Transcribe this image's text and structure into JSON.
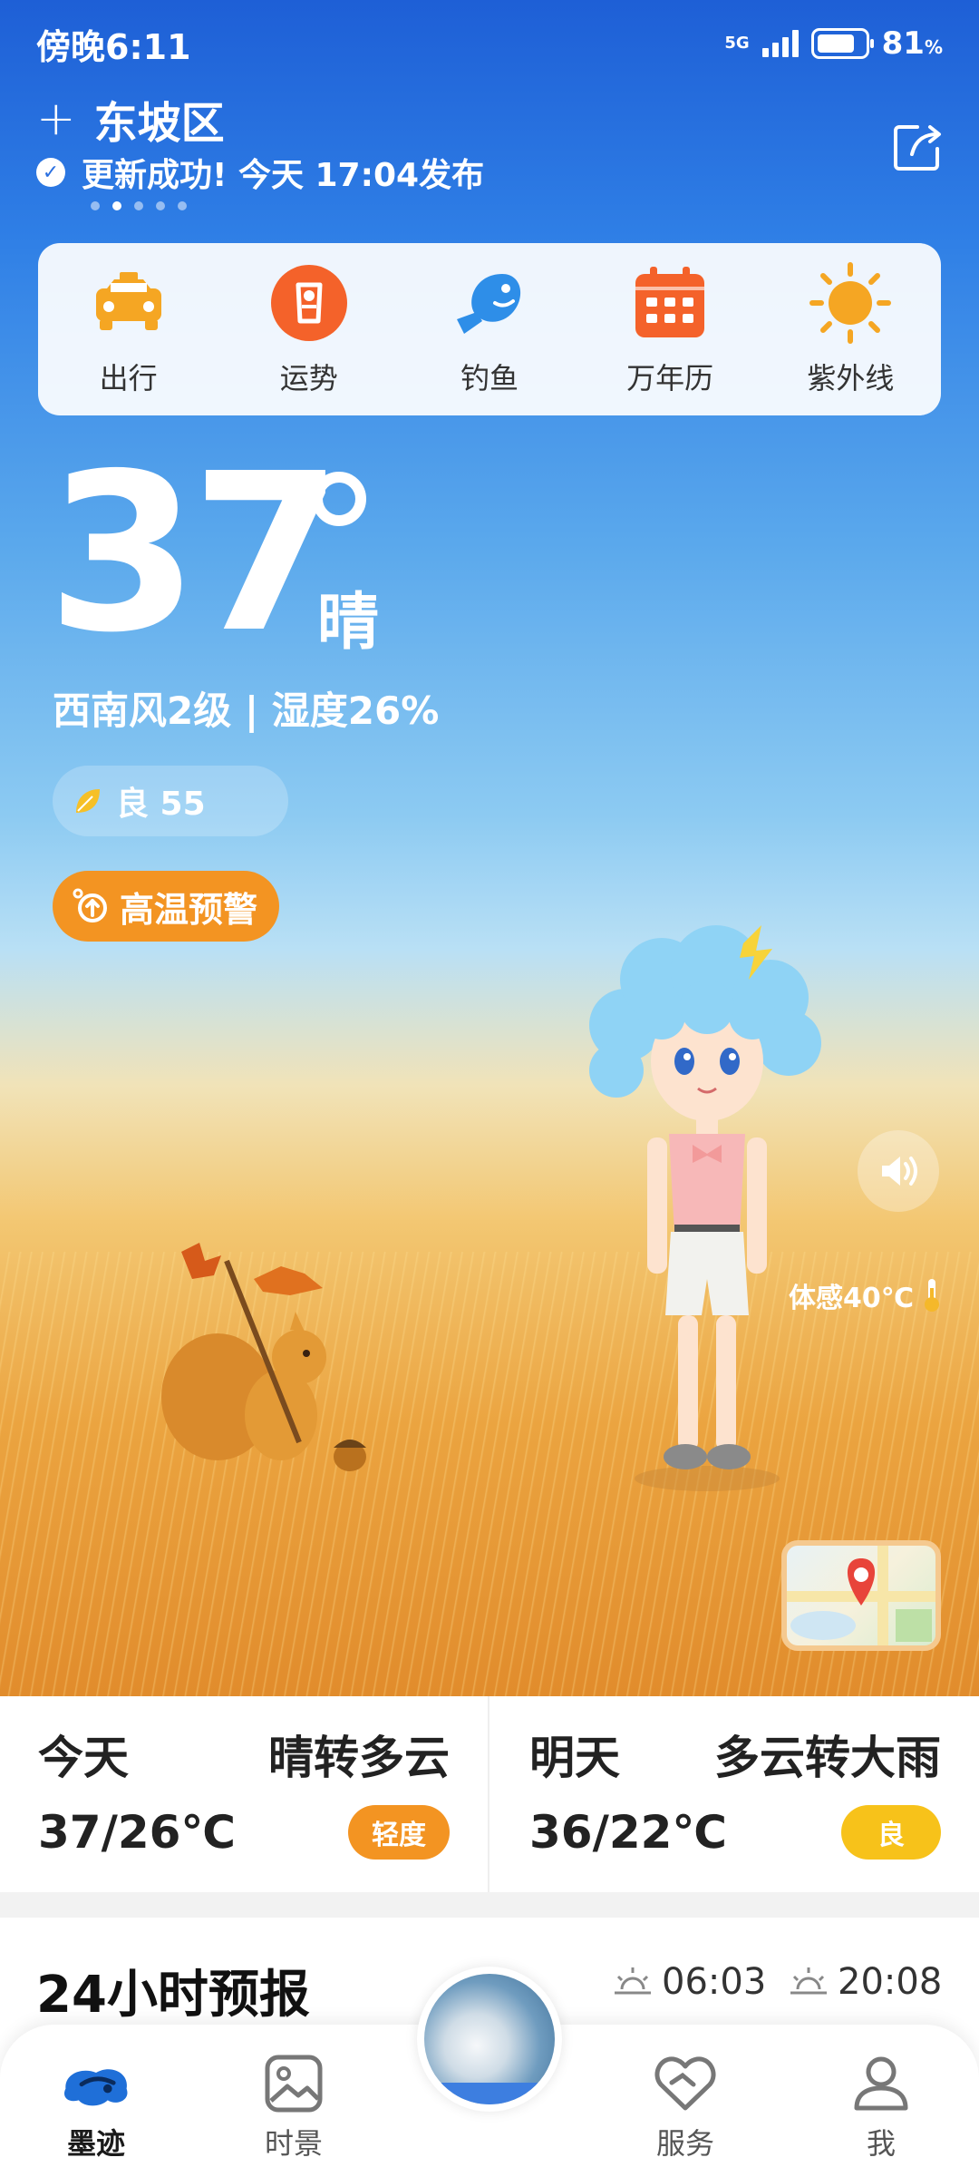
{
  "status_bar": {
    "time": "傍晚6:11",
    "network": "5G",
    "battery_percent": "81",
    "battery_unit": "%"
  },
  "location": {
    "add_symbol": "+",
    "name": "东坡区",
    "update_text": "更新成功! 今天 17:04发布",
    "page_count": 5,
    "active_page": 1
  },
  "quick_tools": [
    {
      "label": "出行",
      "icon": "taxi-icon"
    },
    {
      "label": "运势",
      "icon": "fortune-icon"
    },
    {
      "label": "钓鱼",
      "icon": "fish-icon"
    },
    {
      "label": "万年历",
      "icon": "calendar-icon"
    },
    {
      "label": "紫外线",
      "icon": "sun-icon"
    }
  ],
  "current": {
    "temperature": "37",
    "condition": "晴",
    "wind_humidity": "西南风2级 | 湿度26%",
    "aqi": "良 55",
    "warning": "高温预警",
    "feels_like": "体感40℃"
  },
  "forecast": {
    "today": {
      "day": "今天",
      "condition": "晴转多云",
      "range": "37/26℃",
      "aqi": "轻度",
      "aqi_color": "#f39422"
    },
    "tomorrow": {
      "day": "明天",
      "condition": "多云转大雨",
      "range": "36/22℃",
      "aqi": "良",
      "aqi_color": "#f7c21a"
    }
  },
  "hourly": {
    "title": "24小时预报",
    "sunrise": "06:03",
    "sunset": "20:08"
  },
  "nav": [
    {
      "label": "墨迹",
      "icon": "moji-icon",
      "active": true
    },
    {
      "label": "时景",
      "icon": "picture-icon",
      "active": false
    },
    {
      "label": "服务",
      "icon": "heart-handshake-icon",
      "active": false
    },
    {
      "label": "我",
      "icon": "user-icon",
      "active": false
    }
  ],
  "colors": {
    "accent_orange": "#f39422",
    "sky_top": "#1e5fd6"
  }
}
